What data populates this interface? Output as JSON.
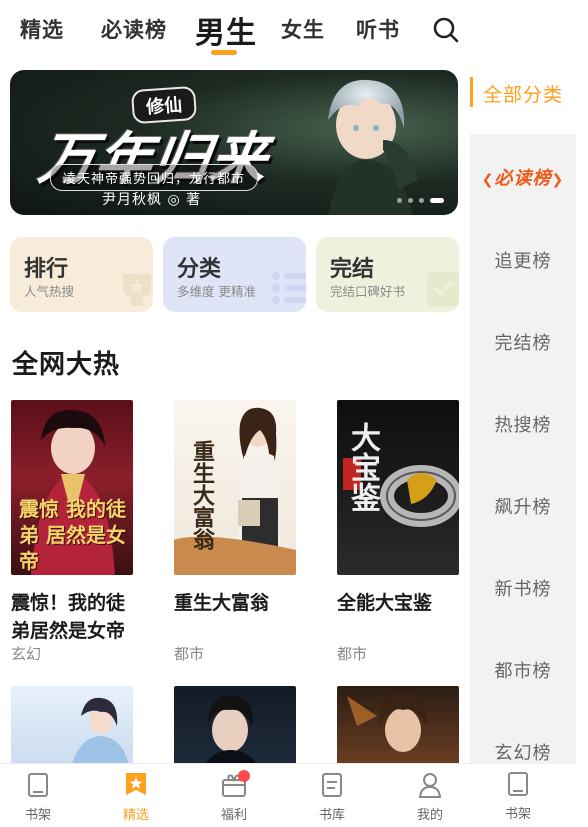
{
  "tabs": [
    {
      "label": "精选"
    },
    {
      "label": "必读榜"
    },
    {
      "label": "男生"
    },
    {
      "label": "女生"
    },
    {
      "label": "听书"
    }
  ],
  "banner": {
    "badge": "修仙",
    "title": "万年归来",
    "subtitle": "凌天神帝强势回归，龙行都市",
    "author": "尹月秋枫 ◎ 著"
  },
  "cards": [
    {
      "title": "排行",
      "subtitle": "人气热搜"
    },
    {
      "title": "分类",
      "subtitle": "多维度 更精准"
    },
    {
      "title": "完结",
      "subtitle": "完结口碑好书"
    }
  ],
  "section": {
    "title": "全网大热"
  },
  "books": [
    {
      "title": "震惊！我的徒弟居然是女帝",
      "genre": "玄幻",
      "cover_text": "震惊 我的徒弟 居然是女帝"
    },
    {
      "title": "重生大富翁",
      "genre": "都市",
      "cover_text": "重生大富翁"
    },
    {
      "title": "全能大宝鉴",
      "genre": "都市",
      "cover_text": "大宝鉴"
    }
  ],
  "sidebar": {
    "all_label": "全部分类",
    "items": [
      {
        "label": "必读榜"
      },
      {
        "label": "追更榜"
      },
      {
        "label": "完结榜"
      },
      {
        "label": "热搜榜"
      },
      {
        "label": "飙升榜"
      },
      {
        "label": "新书榜"
      },
      {
        "label": "都市榜"
      },
      {
        "label": "玄幻榜"
      }
    ],
    "bottom_label": "书架"
  },
  "bottom_nav": [
    {
      "label": "书架",
      "icon": "bookshelf-icon"
    },
    {
      "label": "精选",
      "icon": "featured-icon"
    },
    {
      "label": "福利",
      "icon": "gift-icon"
    },
    {
      "label": "书库",
      "icon": "library-icon"
    },
    {
      "label": "我的",
      "icon": "profile-icon"
    }
  ],
  "colors": {
    "accent": "#ff9f1c",
    "highlight": "#f05a1a"
  }
}
